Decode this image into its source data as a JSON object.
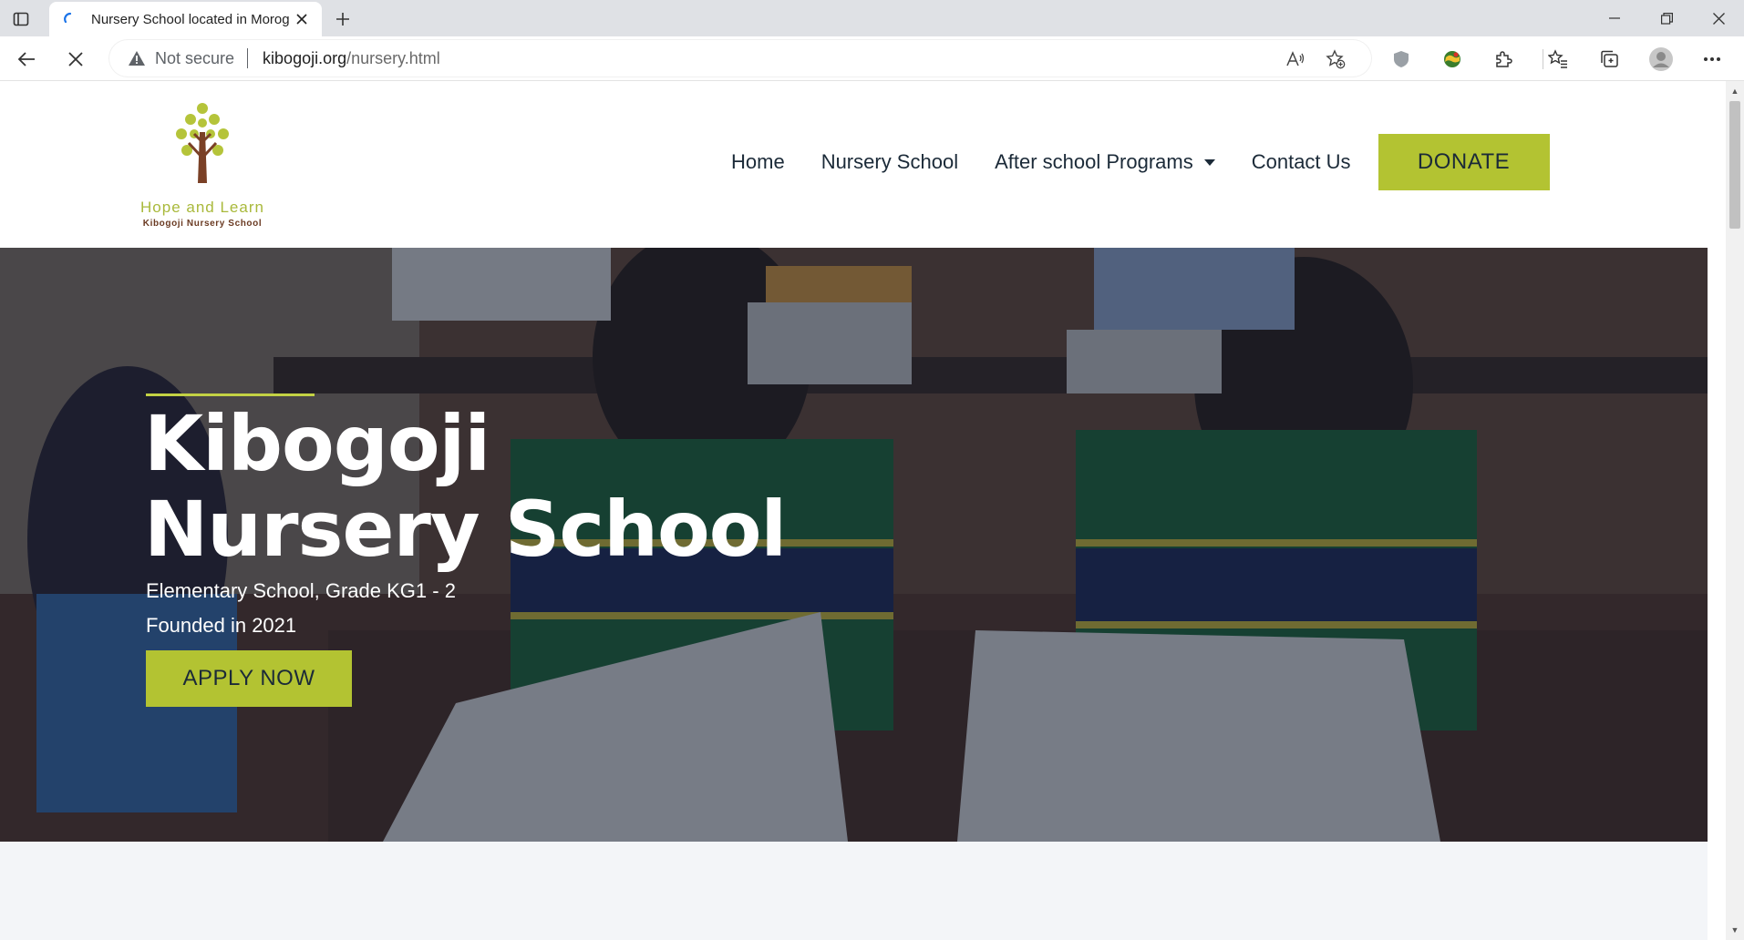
{
  "browser": {
    "tab_title": "Nursery School located in Morog",
    "security_label": "Not secure",
    "url_host": "kibogoji.org",
    "url_path": "/nursery.html",
    "accent": "#1a73e8"
  },
  "site": {
    "logo": {
      "name": "Hope and Learn",
      "tagline": "Kibogoji Nursery School"
    },
    "nav": {
      "items": [
        "Home",
        "Nursery School",
        "After school Programs",
        "Contact Us"
      ],
      "donate_label": "DONATE"
    },
    "hero": {
      "title": "Kibogoji Nursery School",
      "subtitle": "Elementary School, Grade KG1 - 2",
      "founded": "Founded in 2021",
      "cta_label": "APPLY NOW"
    },
    "colors": {
      "brand_green": "#b3c332",
      "navy_text": "#1b2a38",
      "logo_brown": "#6a3a22"
    }
  }
}
